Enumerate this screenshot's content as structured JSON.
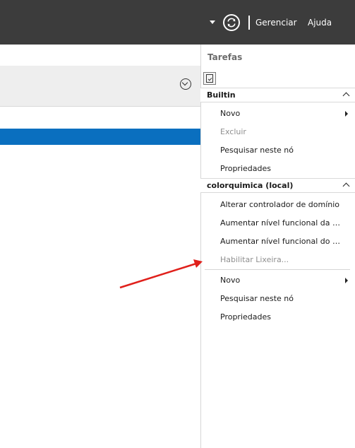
{
  "topbar": {
    "menu_manage": "Gerenciar",
    "menu_help": "Ajuda",
    "refresh_icon": "refresh-icon",
    "dropdown_icon": "dropdown-arrow-icon"
  },
  "tasks": {
    "title": "Tarefas",
    "sections": [
      {
        "label": "Builtin",
        "items": [
          {
            "label": "Novo",
            "enabled": true,
            "submenu": true
          },
          {
            "label": "Excluir",
            "enabled": false,
            "submenu": false
          },
          {
            "label": "Pesquisar neste nó",
            "enabled": true,
            "submenu": false
          },
          {
            "label": "Propriedades",
            "enabled": true,
            "submenu": false
          }
        ]
      },
      {
        "label": "colorquimica (local)",
        "items": [
          {
            "label": "Alterar controlador de domínio",
            "enabled": true,
            "submenu": false
          },
          {
            "label": "Aumentar nível funcional da floresta...",
            "enabled": true,
            "submenu": false
          },
          {
            "label": "Aumentar nível funcional do domínio...",
            "enabled": true,
            "submenu": false
          },
          {
            "label": "Habilitar Lixeira...",
            "enabled": false,
            "submenu": false
          },
          {
            "label": "Novo",
            "enabled": true,
            "submenu": true
          },
          {
            "label": "Pesquisar neste nó",
            "enabled": true,
            "submenu": false
          },
          {
            "label": "Propriedades",
            "enabled": true,
            "submenu": false
          }
        ]
      }
    ]
  },
  "colors": {
    "topbar": "#3c3c3c",
    "selection": "#0a6fbf",
    "annotation": "#e0201b",
    "disabled_text": "#8f8f8f"
  }
}
